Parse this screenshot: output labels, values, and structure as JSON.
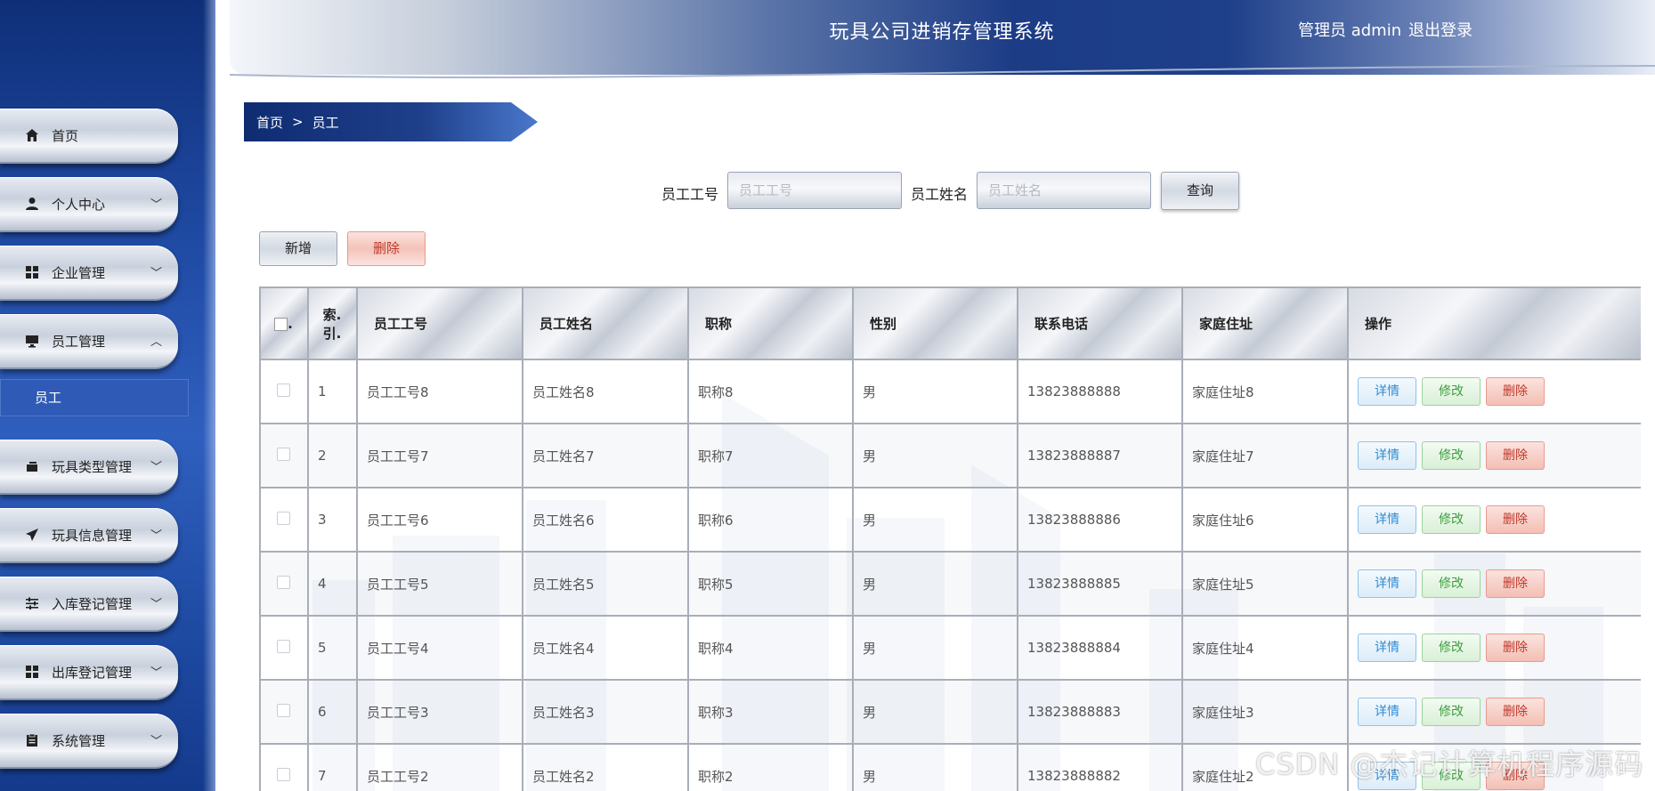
{
  "header": {
    "title": "玩具公司进销存管理系统",
    "user": "管理员 admin",
    "logout": "退出登录"
  },
  "sidebar": {
    "items": [
      {
        "label": "首页",
        "icon": "home-icon"
      },
      {
        "label": "个人中心",
        "icon": "user-icon"
      },
      {
        "label": "企业管理",
        "icon": "grid-icon"
      },
      {
        "label": "员工管理",
        "icon": "monitor-icon"
      },
      {
        "label": "玩具类型管理",
        "icon": "folder-icon"
      },
      {
        "label": "玩具信息管理",
        "icon": "send-icon"
      },
      {
        "label": "入库登记管理",
        "icon": "sliders-icon"
      },
      {
        "label": "出库登记管理",
        "icon": "grid-icon"
      },
      {
        "label": "系统管理",
        "icon": "clipboard-icon"
      }
    ],
    "submenu": {
      "label": "员工"
    }
  },
  "breadcrumb": {
    "home": "首页",
    "sep": ">",
    "current": "员工"
  },
  "search": {
    "id_label": "员工工号",
    "id_placeholder": "员工工号",
    "name_label": "员工姓名",
    "name_placeholder": "员工姓名",
    "query_button": "查询"
  },
  "actions": {
    "add": "新增",
    "delete": "删除"
  },
  "table": {
    "headers": {
      "index_line1": "索.",
      "index_line2": "引.",
      "id": "员工工号",
      "name": "员工姓名",
      "title": "职称",
      "gender": "性别",
      "phone": "联系电话",
      "address": "家庭住址",
      "ops": "操作"
    },
    "op_labels": {
      "detail": "详情",
      "edit": "修改",
      "delete": "删除"
    },
    "rows": [
      {
        "index": "1",
        "id": "员工工号8",
        "name": "员工姓名8",
        "title": "职称8",
        "gender": "男",
        "phone": "13823888888",
        "address": "家庭住址8"
      },
      {
        "index": "2",
        "id": "员工工号7",
        "name": "员工姓名7",
        "title": "职称7",
        "gender": "男",
        "phone": "13823888887",
        "address": "家庭住址7"
      },
      {
        "index": "3",
        "id": "员工工号6",
        "name": "员工姓名6",
        "title": "职称6",
        "gender": "男",
        "phone": "13823888886",
        "address": "家庭住址6"
      },
      {
        "index": "4",
        "id": "员工工号5",
        "name": "员工姓名5",
        "title": "职称5",
        "gender": "男",
        "phone": "13823888885",
        "address": "家庭住址5"
      },
      {
        "index": "5",
        "id": "员工工号4",
        "name": "员工姓名4",
        "title": "职称4",
        "gender": "男",
        "phone": "13823888884",
        "address": "家庭住址4"
      },
      {
        "index": "6",
        "id": "员工工号3",
        "name": "员工姓名3",
        "title": "职称3",
        "gender": "男",
        "phone": "13823888883",
        "address": "家庭住址3"
      },
      {
        "index": "7",
        "id": "员工工号2",
        "name": "员工姓名2",
        "title": "职称2",
        "gender": "男",
        "phone": "13823888882",
        "address": "家庭住址2"
      }
    ]
  },
  "watermark": "CSDN @杰记计算机程序源码"
}
